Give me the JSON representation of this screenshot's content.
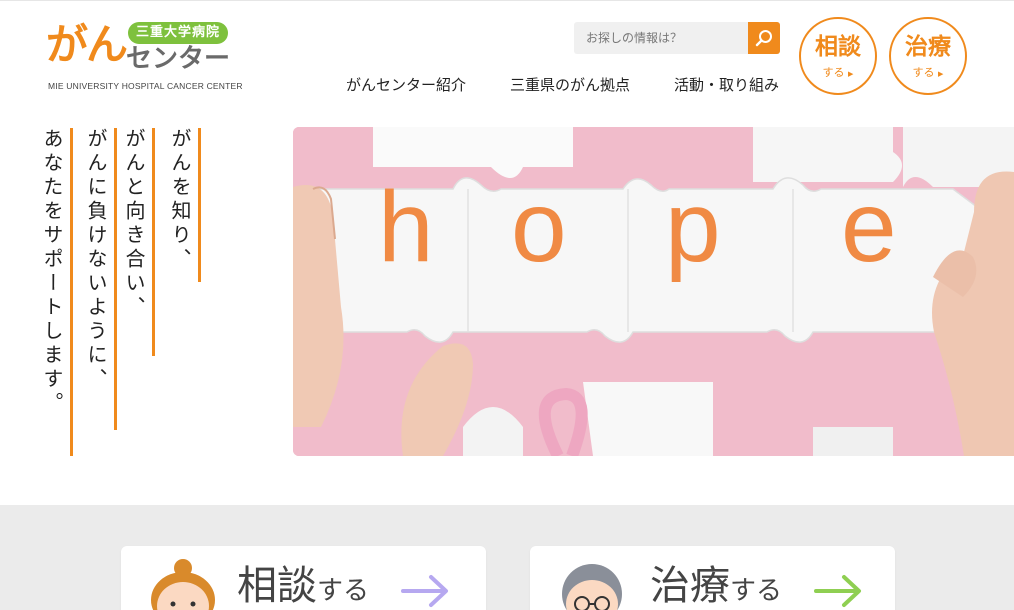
{
  "logo": {
    "gan": "がん",
    "badge": "三重大学病院",
    "center": "センター",
    "english": "MIE UNIVERSITY HOSPITAL CANCER CENTER"
  },
  "search": {
    "placeholder": "お探しの情報は？",
    "button_icon": "search-icon"
  },
  "nav": {
    "items": [
      {
        "label": "がんセンター紹介"
      },
      {
        "label": "三重県のがん拠点"
      },
      {
        "label": "活動・取り組み"
      }
    ]
  },
  "round_buttons": {
    "consult": {
      "big": "相談",
      "small": "する",
      "icon": "triangle-right-icon"
    },
    "treat": {
      "big": "治療",
      "small": "する",
      "icon": "triangle-right-icon"
    }
  },
  "tagline": {
    "lines": [
      "がんを知り、",
      "がんと向き合い、",
      "がんに負けないように、",
      "あなたをサポートします。"
    ]
  },
  "hero": {
    "letters": [
      "h",
      "o",
      "p",
      "e"
    ]
  },
  "cards": {
    "consult": {
      "title": "相談",
      "suffix": "する",
      "icon": "arrow-right-icon",
      "arrow_color": "#b6a8f0"
    },
    "treat": {
      "title": "治療",
      "suffix": "する",
      "icon": "arrow-right-icon",
      "arrow_color": "#8fcf52"
    }
  },
  "colors": {
    "accent": "#f08a1c",
    "green": "#7ec13d",
    "pink": "#f1b9c5"
  }
}
